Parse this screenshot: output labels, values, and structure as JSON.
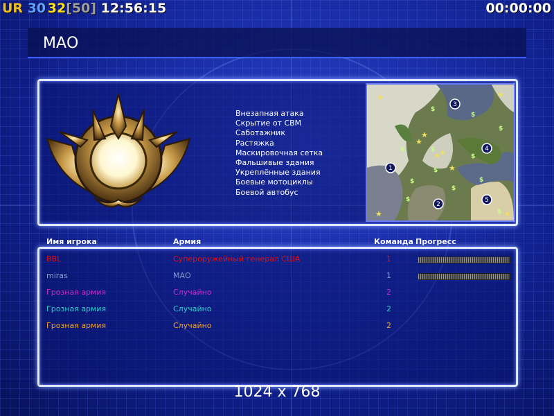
{
  "hud": {
    "prefix": "UR",
    "num1": "30",
    "num2": "32",
    "bracket_val": "[50]",
    "clock": "12:56:15",
    "timer": "00:00:00"
  },
  "faction_title": "МАО",
  "features": [
    "Внезапная атака",
    "Скрытие от СВМ",
    "Саботажник",
    "Растяжка",
    "Маскировочная сетка",
    "Фальшивые здания",
    "Укреплённые здания",
    "Боевые мотоциклы",
    "Боевой автобус"
  ],
  "minimap": {
    "start_positions": [
      "1",
      "2",
      "3",
      "4",
      "5"
    ]
  },
  "columns": {
    "player": "Имя игрока",
    "army": "Армия",
    "team": "Команда",
    "progress": "Прогресс"
  },
  "players": [
    {
      "name": "BBL",
      "army": "Супероружейный генерал США",
      "team": "1",
      "color": "#e01010",
      "progress": 1.0
    },
    {
      "name": "miras",
      "army": "МАО",
      "team": "1",
      "color": "#8a9ad0",
      "progress": 1.0
    },
    {
      "name": "Грозная армия",
      "army": "Случайно",
      "team": "2",
      "color": "#d028c8",
      "progress": null
    },
    {
      "name": "Грозная армия",
      "army": "Случайно",
      "team": "2",
      "color": "#28d0c8",
      "progress": null
    },
    {
      "name": "Грозная армия",
      "army": "Случайно",
      "team": "2",
      "color": "#f0a020",
      "progress": null
    }
  ],
  "resolution": "1024 x 768",
  "colors": {
    "hud_prefix": "#f0c020",
    "hud_num1": "#60a0ff",
    "hud_num2": "#ffe020",
    "hud_bracket": "#a0a0a0",
    "accent": "#3e5cff"
  }
}
